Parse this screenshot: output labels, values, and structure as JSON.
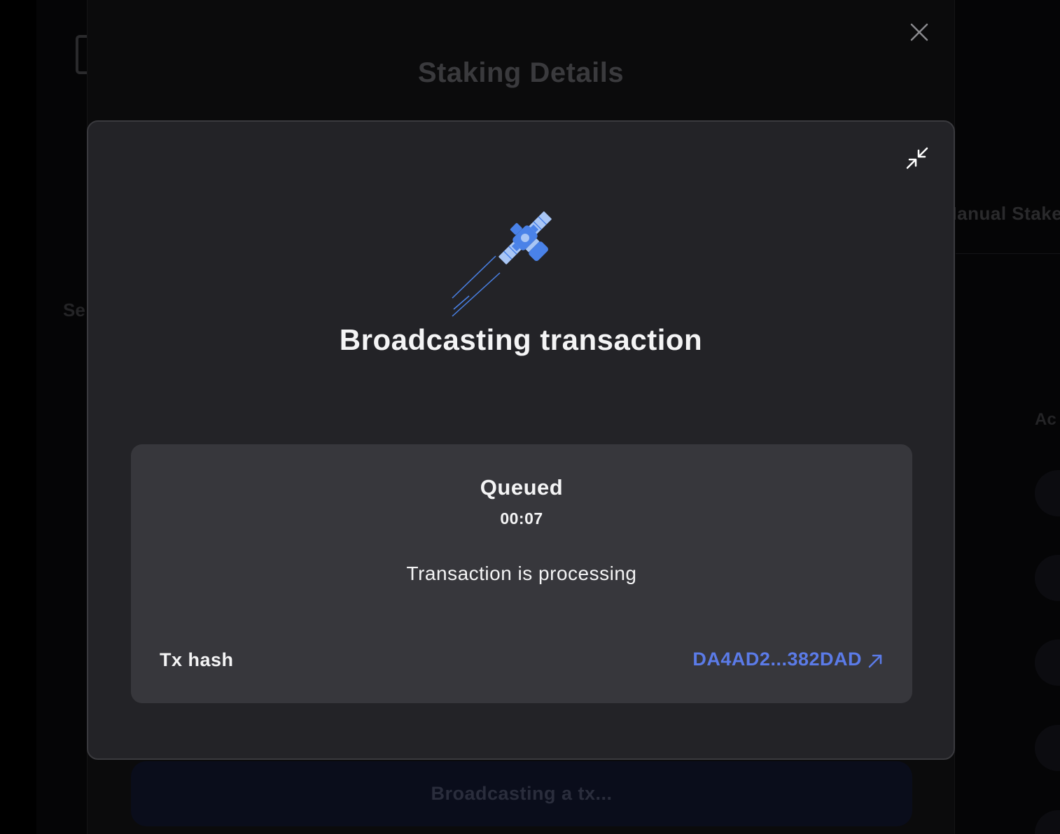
{
  "background": {
    "manual_stake_text": "Manual Stake",
    "side_text_left": "Se",
    "side_text_right": "Ac"
  },
  "staking_modal": {
    "title": "Staking Details",
    "close_icon": "close-icon",
    "broadcast_button_label": "Broadcasting a tx..."
  },
  "tx_dialog": {
    "minimize_icon": "minimize-icon",
    "illustration_icon": "satellite-icon",
    "title": "Broadcasting transaction",
    "status": {
      "label": "Queued",
      "timer": "00:07",
      "message": "Transaction is processing"
    },
    "tx_hash": {
      "label": "Tx hash",
      "value": "DA4AD2...382DAD",
      "link_icon": "external-link-icon"
    }
  },
  "colors": {
    "dialog_bg": "#232327",
    "card_bg": "#37373c",
    "link": "#5b7be8",
    "satellite_primary": "#4a82e8",
    "satellite_light": "#a9c6f5"
  }
}
